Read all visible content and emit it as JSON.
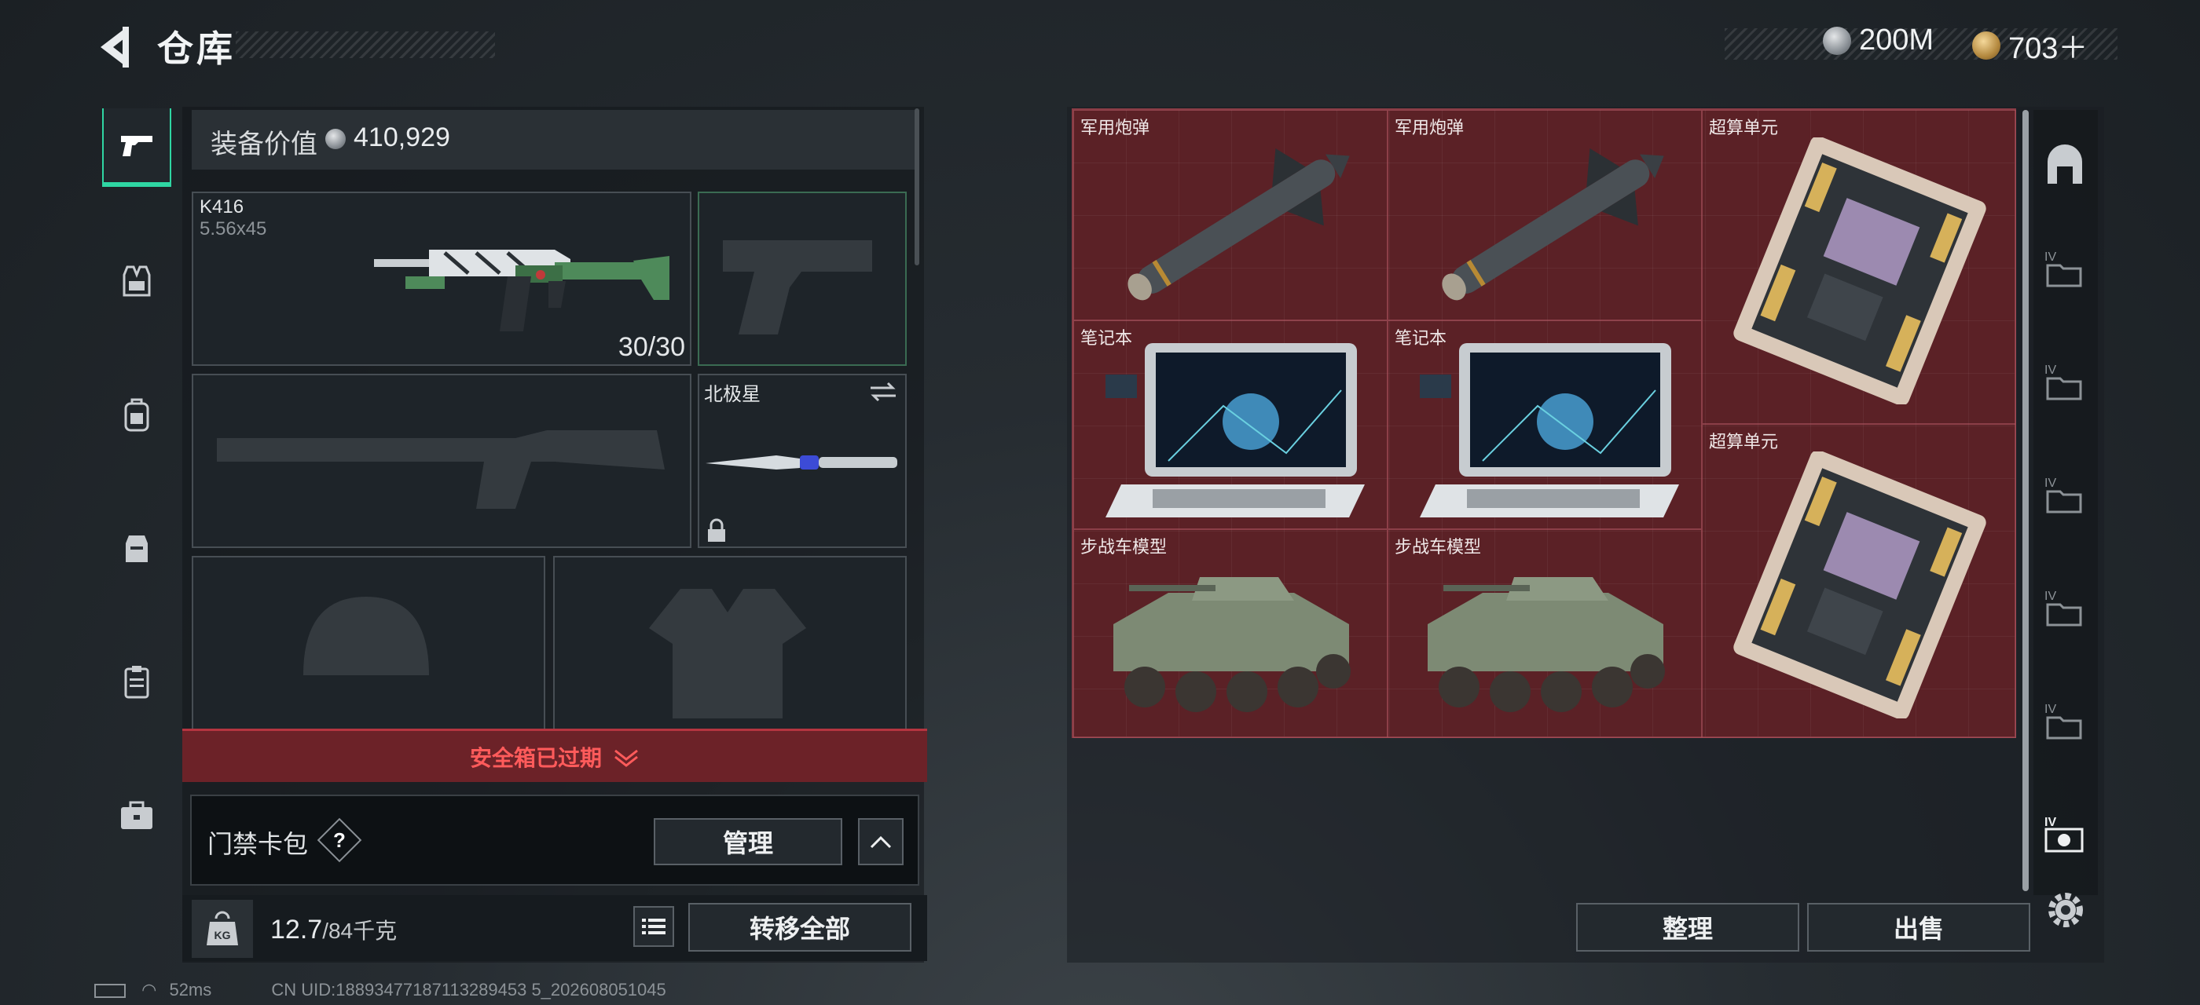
{
  "header": {
    "title": "仓库",
    "currencies": [
      {
        "name": "silver-coin-icon",
        "value": "200M"
      },
      {
        "name": "gold-coin-icon",
        "value": "703＋"
      }
    ]
  },
  "left_tabs": [
    {
      "icon": "pistol-icon",
      "active": true
    },
    {
      "icon": "vest-icon",
      "active": false
    },
    {
      "icon": "backpack-icon",
      "active": false
    },
    {
      "icon": "chest-rig-icon",
      "active": false
    },
    {
      "icon": "clipboard-icon",
      "active": false
    },
    {
      "icon": "briefcase-icon",
      "active": false
    }
  ],
  "equipment": {
    "value_label": "装备价值",
    "value": "410,929",
    "primary_weapon": {
      "name": "K416",
      "ammo_type": "5.56x45",
      "ammo": "30/30"
    },
    "melee": {
      "name": "北极星"
    }
  },
  "safe_box": {
    "status": "安全箱已过期"
  },
  "card_pack": {
    "label": "门禁卡包",
    "help": "?",
    "manage_label": "管理"
  },
  "weight": {
    "current": "12.7",
    "max": "/84千克",
    "kg_badge": "KG"
  },
  "transfer_all_label": "转移全部",
  "storage": {
    "items": [
      {
        "label": "军用炮弹",
        "icon": "missile-icon"
      },
      {
        "label": "军用炮弹",
        "icon": "missile-icon"
      },
      {
        "label": "超算单元",
        "icon": "supercomputer-unit-icon"
      },
      {
        "label": "笔记本",
        "icon": "laptop-icon"
      },
      {
        "label": "笔记本",
        "icon": "laptop-icon"
      },
      {
        "label": "超算单元",
        "icon": "supercomputer-unit-icon"
      },
      {
        "label": "步战车模型",
        "icon": "ifv-model-icon"
      },
      {
        "label": "步战车模型",
        "icon": "ifv-model-icon"
      }
    ],
    "sort_label": "整理",
    "sell_label": "出售"
  },
  "right_tabs": [
    {
      "icon": "gate-icon",
      "badge": ""
    },
    {
      "icon": "folder-icon",
      "badge": "IV"
    },
    {
      "icon": "folder-icon",
      "badge": "IV"
    },
    {
      "icon": "folder-icon",
      "badge": "IV"
    },
    {
      "icon": "folder-icon",
      "badge": "IV"
    },
    {
      "icon": "folder-icon",
      "badge": "IV"
    },
    {
      "icon": "gear-folder-icon",
      "badge": "IV"
    }
  ],
  "status_bar": {
    "ping": "52ms",
    "uid": "CN UID:18893477187113289453 5_202608051045"
  },
  "colors": {
    "accent": "#2fd6a3",
    "warning": "#ff5b5b",
    "grid_bg": "#5b2126"
  }
}
